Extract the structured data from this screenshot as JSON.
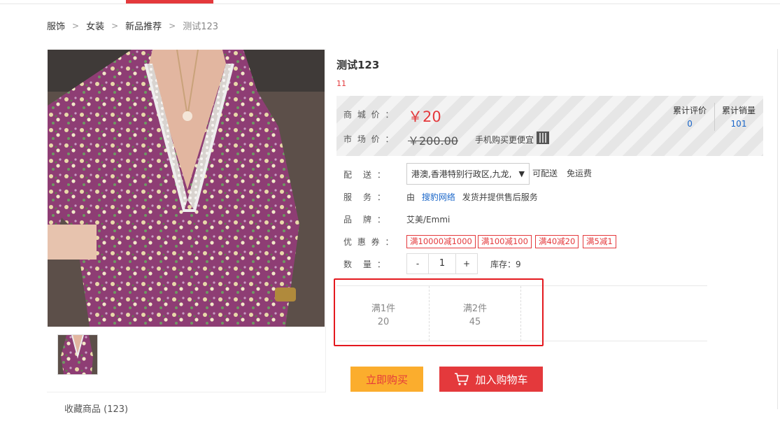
{
  "breadcrumb": {
    "items": [
      "服饰",
      "女装",
      "新品推荐"
    ],
    "current": "测试123"
  },
  "product": {
    "title": "测试123",
    "subtitle": "11"
  },
  "price": {
    "shop_label": "商 城 价 ：",
    "shop_price": "￥20",
    "market_label": "市 场 价 ：",
    "market_price": "￥200.00",
    "mobile_text": "手机购买更便宜"
  },
  "stats": {
    "reviews_label": "累计评价",
    "reviews_value": "0",
    "sales_label": "累计销量",
    "sales_value": "101"
  },
  "delivery": {
    "label": "配　送 ：",
    "region": "港澳,香港特别行政区,九龙,",
    "status": "可配送",
    "fee": "免运费"
  },
  "service": {
    "label": "服　务 ：",
    "prefix": "由",
    "seller": "搜豹网络",
    "suffix": "发货并提供售后服务"
  },
  "brand": {
    "label": "品　牌 ：",
    "value": "艾美/Emmi"
  },
  "coupons": {
    "label": "优 惠 券 ：",
    "items": [
      "满10000减1000",
      "满100减100",
      "满40减20",
      "满5减1"
    ]
  },
  "quantity": {
    "label": "数　量 ：",
    "minus": "-",
    "value": "1",
    "plus": "+",
    "stock": "库存：9"
  },
  "tiers": [
    {
      "label": "满1件",
      "price": "20"
    },
    {
      "label": "满2件",
      "price": "45"
    }
  ],
  "actions": {
    "buy_now": "立即购买",
    "add_to_cart": "加入购物车"
  },
  "favorite": "收藏商品 (123)",
  "colors": {
    "accent": "#e4393c",
    "buy_button": "#fbad2d",
    "link": "#1a66c9",
    "highlight_border": "#e4191f"
  }
}
